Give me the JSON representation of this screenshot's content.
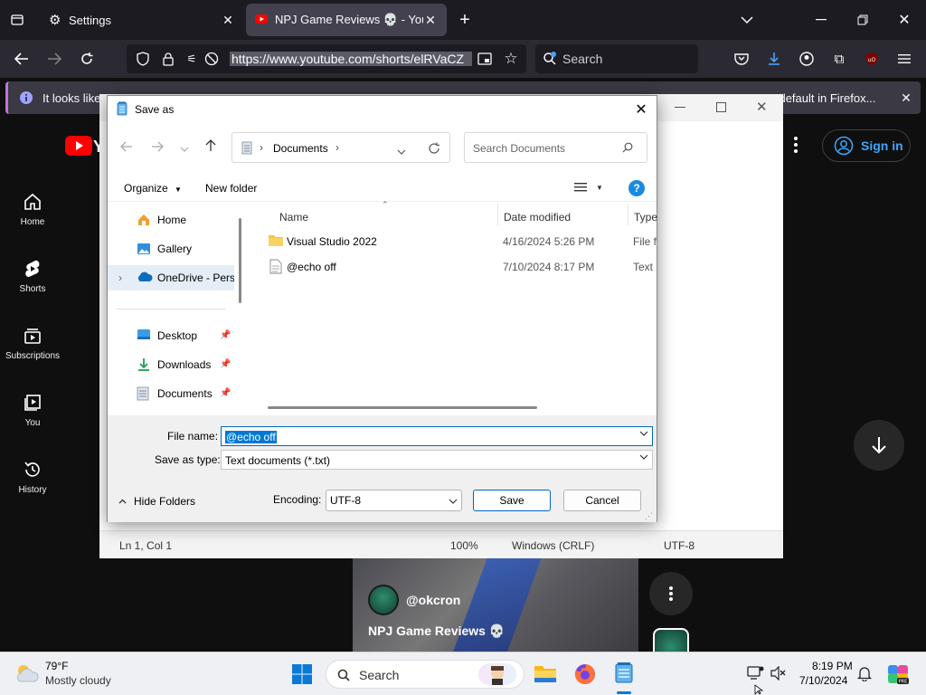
{
  "browser": {
    "tabs": [
      {
        "label": "Settings",
        "icon": "gear-icon"
      },
      {
        "label": "NPJ Game Reviews 💀 - YouTube",
        "icon": "youtube-icon"
      }
    ],
    "url": "https://www.youtube.com/shorts/elRVaCZ",
    "search_placeholder": "Search",
    "infobar_text": "It looks like y",
    "infobar_button": "Set as default in Firefox..."
  },
  "youtube": {
    "sidebar": [
      {
        "label": "Home",
        "icon": "home-icon"
      },
      {
        "label": "Shorts",
        "icon": "shorts-icon"
      },
      {
        "label": "Subscriptions",
        "icon": "subscriptions-icon"
      },
      {
        "label": "You",
        "icon": "you-icon"
      },
      {
        "label": "History",
        "icon": "history-icon"
      }
    ],
    "signin_label": "Sign in",
    "channel": "@okcron",
    "video_title": "NPJ Game Reviews 💀"
  },
  "notepad": {
    "status": {
      "position": "Ln 1, Col 1",
      "zoom": "100%",
      "line_endings": "Windows (CRLF)",
      "encoding": "UTF-8"
    }
  },
  "dialog": {
    "title": "Save as",
    "address": "Documents",
    "search_placeholder": "Search Documents",
    "organize_label": "Organize",
    "new_folder_label": "New folder",
    "nav_items": [
      {
        "label": "Home",
        "icon": "home-icon",
        "pinned": false
      },
      {
        "label": "Gallery",
        "icon": "gallery-icon",
        "pinned": false
      },
      {
        "label": "OneDrive - Personal",
        "icon": "onedrive-icon",
        "pinned": false
      },
      {
        "label": "Desktop",
        "icon": "desktop-icon",
        "pinned": true
      },
      {
        "label": "Downloads",
        "icon": "downloads-icon",
        "pinned": true
      },
      {
        "label": "Documents",
        "icon": "documents-icon",
        "pinned": true
      }
    ],
    "columns": {
      "name": "Name",
      "date": "Date modified",
      "type": "Type"
    },
    "files": [
      {
        "name": "Visual Studio 2022",
        "date": "4/16/2024 5:26 PM",
        "type": "File folder",
        "icon": "folder-icon"
      },
      {
        "name": "@echo off",
        "date": "7/10/2024 8:17 PM",
        "type": "Text Document",
        "icon": "text-file-icon"
      }
    ],
    "file_name_label": "File name:",
    "file_name_value": "@echo off",
    "save_type_label": "Save as type:",
    "save_type_value": "Text documents (*.txt)",
    "hide_folders_label": "Hide Folders",
    "encoding_label": "Encoding:",
    "encoding_value": "UTF-8",
    "save_label": "Save",
    "cancel_label": "Cancel"
  },
  "taskbar": {
    "weather_temp": "79°F",
    "weather_desc": "Mostly cloudy",
    "search_placeholder": "Search",
    "time": "8:19 PM",
    "date": "7/10/2024"
  }
}
